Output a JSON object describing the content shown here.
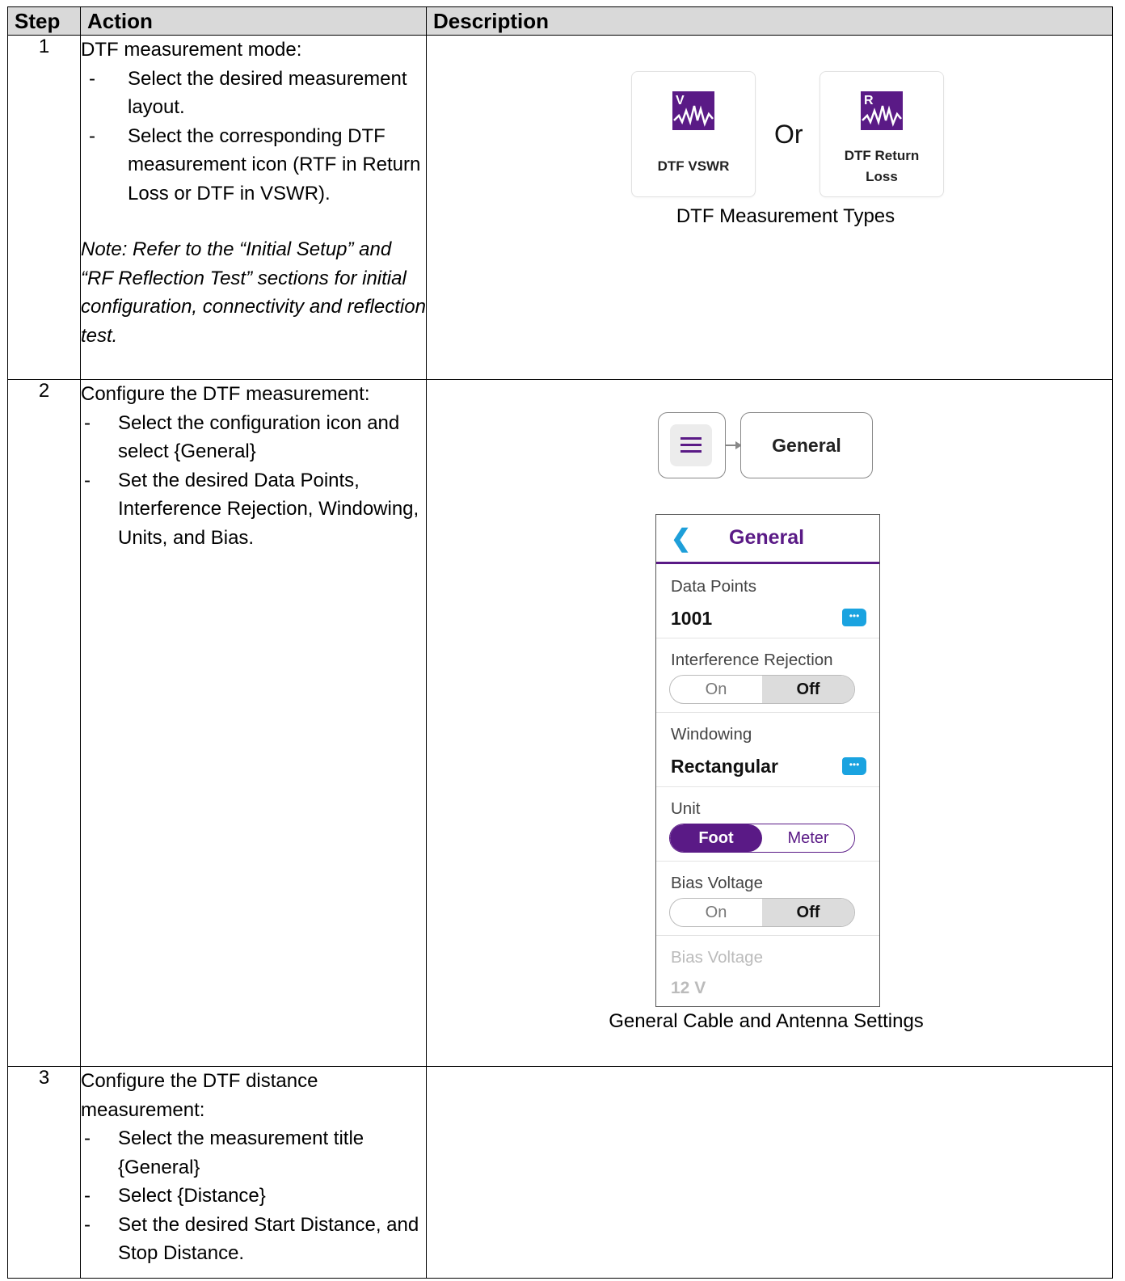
{
  "table": {
    "headers": {
      "step": "Step",
      "action": "Action",
      "description": "Description"
    },
    "rows": [
      {
        "step": "1",
        "intro": "DTF measurement mode:",
        "bullets": [
          "Select the desired measurement layout.",
          "Select the corresponding DTF measurement icon (RTF in Return Loss or DTF in VSWR)."
        ],
        "note": "Note: Refer to the “Initial Setup” and “RF Reflection Test” sections for initial configuration, connectivity and reflection test.",
        "figure": {
          "tile_1_label": "DTF VSWR",
          "tile_1_icon": "dtf-vswr-icon",
          "tile_1_icon_letter": "V",
          "separator": "Or",
          "tile_2_label": "DTF Return Loss",
          "tile_2_icon": "dtf-return-loss-icon",
          "tile_2_icon_letter": "R",
          "caption": "DTF Measurement Types"
        }
      },
      {
        "step": "2",
        "intro": "Configure the DTF measurement:",
        "bullets": [
          "Select the configuration icon and select {General}",
          "Set the desired Data Points, Interference Rejection, Windowing, Units, and Bias."
        ],
        "figure": {
          "menu_icon": "hamburger-menu-icon",
          "general_button": "General",
          "panel": {
            "title": "General",
            "back_icon": "chevron-left-icon",
            "data_points_label": "Data Points",
            "data_points_value": "1001",
            "interference_label": "Interference Rejection",
            "interference_on": "On",
            "interference_off": "Off",
            "interference_selected": "Off",
            "windowing_label": "Windowing",
            "windowing_value": "Rectangular",
            "unit_label": "Unit",
            "unit_foot": "Foot",
            "unit_meter": "Meter",
            "unit_selected": "Foot",
            "bias_label": "Bias Voltage",
            "bias_on": "On",
            "bias_off": "Off",
            "bias_selected": "Off",
            "bias_voltage_label": "Bias Voltage",
            "bias_voltage_value": "12 V",
            "edit_icon": "more-dots-icon"
          },
          "caption": "General Cable and Antenna Settings"
        }
      },
      {
        "step": "3",
        "intro": "Configure the DTF distance measurement:",
        "bullets": [
          "Select the measurement title {General}",
          "Select {Distance}",
          "Set the desired Start Distance, and Stop Distance."
        ]
      }
    ]
  },
  "colors": {
    "brand_purple": "#5a1a86",
    "accent_blue": "#1aa3e0",
    "header_gray": "#d9d9d9"
  }
}
